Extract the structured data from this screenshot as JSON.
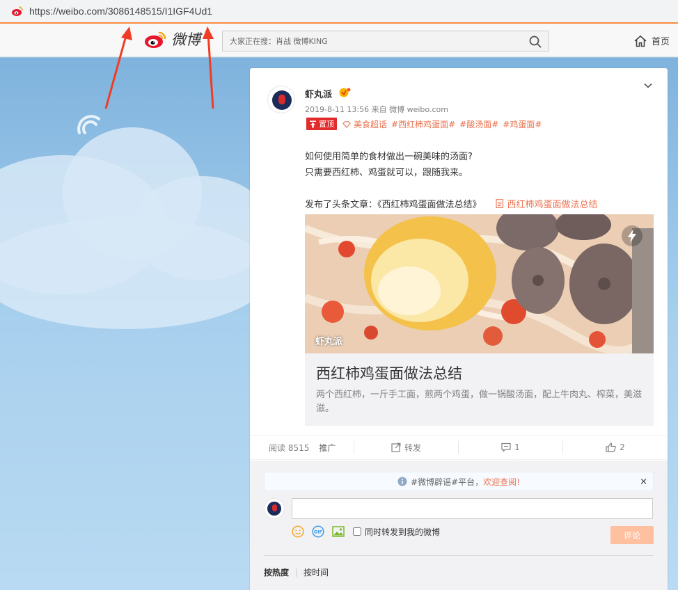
{
  "browser": {
    "url": "https://weibo.com/3086148515/I1IGF4Ud1",
    "favicon": "weibo-favicon"
  },
  "nav": {
    "logo_text": "微博",
    "search_placeholder": "大家正在搜：肖战 微博KING",
    "home_label": "首页"
  },
  "post": {
    "author": "虾丸派",
    "meta": "2019-8-11 13:56 来自 微博 weibo.com",
    "pinned_label": "置顶",
    "tags": [
      "美食超话",
      "#西红柿鸡蛋面#",
      "#酸汤面#",
      "#鸡蛋面#"
    ],
    "body_lines": [
      "如何使用简单的食材做出一碗美味的汤面?",
      "只需要西红柿、鸡蛋就可以，跟随我来。"
    ],
    "article_prefix": "发布了头条文章：《西红柿鸡蛋面做法总结》",
    "article_link": "西红柿鸡蛋面做法总结",
    "article_card": {
      "image_author": "虾丸派",
      "title": "西红柿鸡蛋面做法总结",
      "description": "两个西红柿，一斤手工面，煎两个鸡蛋，做一锅酸汤面，配上牛肉丸、榨菜，美滋滋。"
    }
  },
  "actions": {
    "read_label": "阅读 8515",
    "promote_label": "推广",
    "repost_label": "转发",
    "comment_count": "1",
    "like_count": "2"
  },
  "comments": {
    "notice_prefix": "#微博辟谣#平台，",
    "notice_link": "欢迎查阅!",
    "notice_close": "×",
    "input_value": "",
    "repost_checkbox_label": "同时转发到我的微博",
    "submit_label": "评论",
    "sort_hot": "按热度",
    "sort_time": "按时间"
  },
  "colors": {
    "accent": "#eb7350",
    "pinned": "#e22c2c",
    "loading_bar": "#f98b42",
    "annotation_arrow": "#f03c24"
  }
}
